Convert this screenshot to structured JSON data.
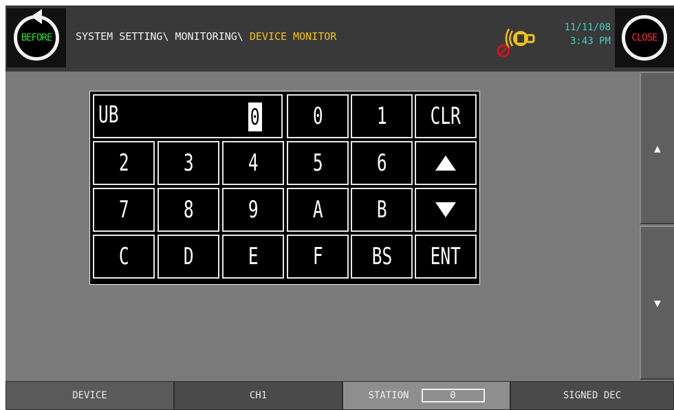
{
  "header": {
    "before_label": "BEFORE",
    "close_label": "CLOSE",
    "breadcrumb_path": "SYSTEM SETTING\\ MONITORING\\ ",
    "breadcrumb_current": "DEVICE MONITOR",
    "date": "11/11/08",
    "time": "3:43 PM",
    "alarm_icon": "alarm-bell-muted-icon"
  },
  "keypad": {
    "device": "UB",
    "value": "0",
    "rows": [
      [
        "0",
        "1",
        "CLR"
      ],
      [
        "2",
        "3",
        "4",
        "5",
        "6",
        "up"
      ],
      [
        "7",
        "8",
        "9",
        "A",
        "B",
        "down"
      ],
      [
        "C",
        "D",
        "E",
        "F",
        "BS",
        "ENT"
      ]
    ]
  },
  "side": {
    "up_icon": "▲",
    "down_icon": "▼"
  },
  "footer": {
    "device_label": "DEVICE",
    "ch1_label": "CH1",
    "station_label": "STATION",
    "station_value": "0",
    "signed_label": "SIGNED DEC"
  },
  "colors": {
    "background": "#7b7b7b",
    "header": "#393939",
    "accent_yellow": "#f2c21a",
    "datetime_cyan": "#3fd0c6",
    "before_green": "#2fe02f",
    "close_red": "#ff3030"
  }
}
